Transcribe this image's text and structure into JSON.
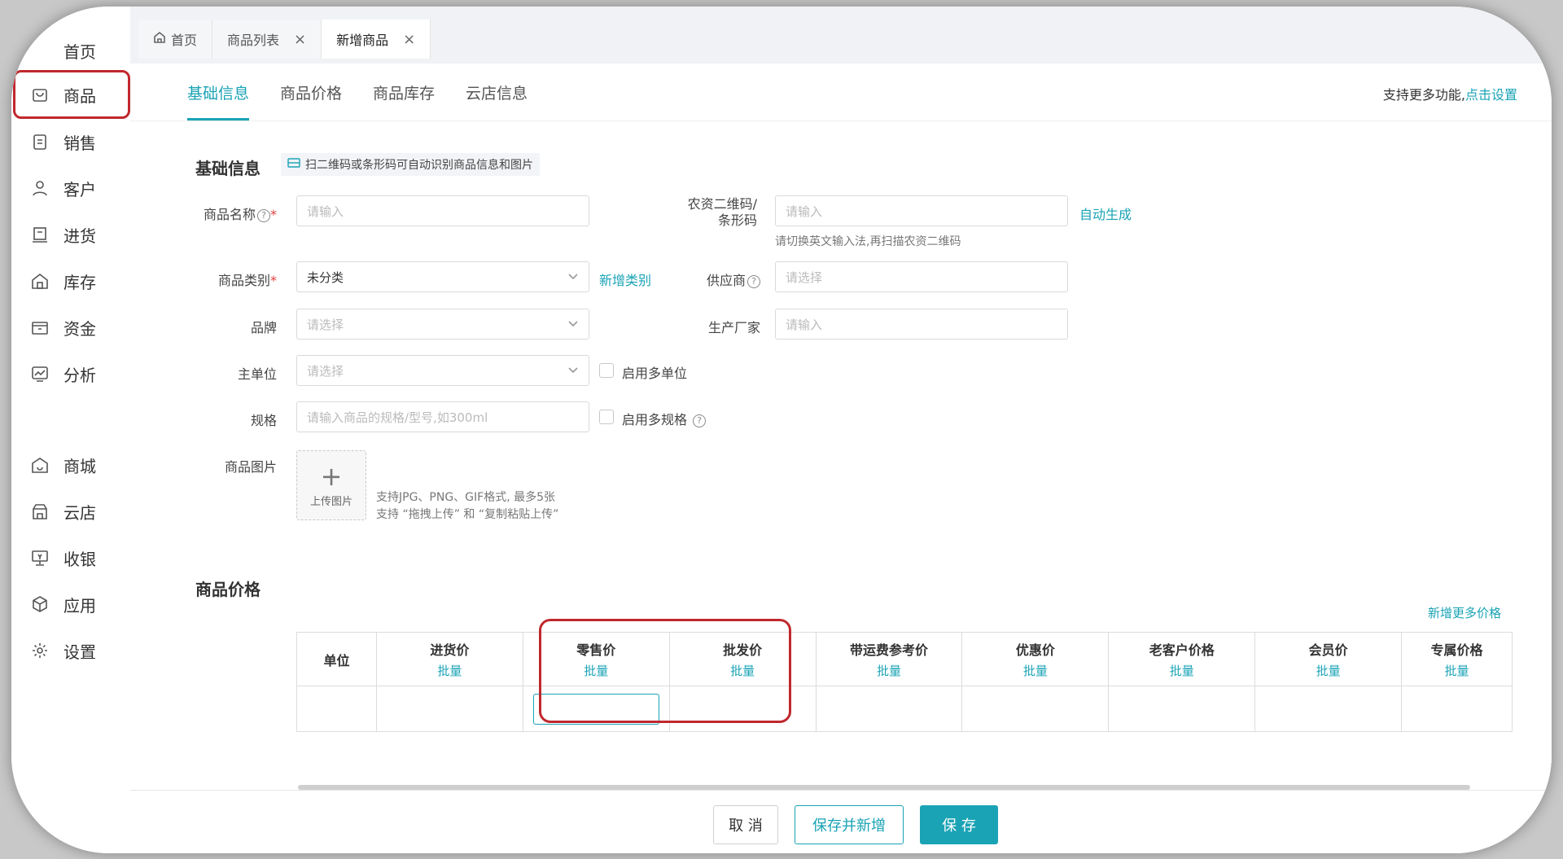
{
  "sidebar": {
    "home": "首页",
    "items": [
      {
        "label": "商品",
        "icon": "bag-icon"
      },
      {
        "label": "销售",
        "icon": "clipboard-icon"
      },
      {
        "label": "客户",
        "icon": "user-icon"
      },
      {
        "label": "进货",
        "icon": "purchase-icon"
      },
      {
        "label": "库存",
        "icon": "warehouse-icon"
      },
      {
        "label": "资金",
        "icon": "wallet-icon"
      },
      {
        "label": "分析",
        "icon": "chart-icon"
      },
      {
        "label": "商城",
        "icon": "mall-icon"
      },
      {
        "label": "云店",
        "icon": "cloud-store-icon"
      },
      {
        "label": "收银",
        "icon": "cashier-icon"
      },
      {
        "label": "应用",
        "icon": "cube-icon"
      },
      {
        "label": "设置",
        "icon": "gear-icon"
      }
    ]
  },
  "tabs": {
    "home": "首页",
    "product_list": "商品列表",
    "new_product": "新增商品",
    "close": "×"
  },
  "subtabs": [
    "基础信息",
    "商品价格",
    "商品库存",
    "云店信息"
  ],
  "more_func": {
    "text": "支持更多功能,",
    "link": "点击设置"
  },
  "basic": {
    "title": "基础信息",
    "scan_tip": "扫二维码或条形码可自动识别商品信息和图片",
    "name_label": "商品名称",
    "name_placeholder": "请输入",
    "qrcode_label_1": "农资二维码/",
    "qrcode_label_2": "条形码",
    "qrcode_placeholder": "请输入",
    "auto_generate": "自动生成",
    "qrcode_hint": "请切换英文输入法,再扫描农资二维码",
    "category_label": "商品类别",
    "category_value": "未分类",
    "add_category": "新增类别",
    "supplier_label": "供应商",
    "supplier_placeholder": "请选择",
    "brand_label": "品牌",
    "brand_placeholder": "请选择",
    "manufacturer_label": "生产厂家",
    "manufacturer_placeholder": "请输入",
    "unit_label": "主单位",
    "unit_placeholder": "请选择",
    "multi_unit": "启用多单位",
    "spec_label": "规格",
    "spec_placeholder": "请输入商品的规格/型号,如300ml",
    "multi_spec": "启用多规格",
    "image_label": "商品图片",
    "upload": "上传图片",
    "upload_hint_1": "支持JPG、PNG、GIF格式, 最多5张",
    "upload_hint_2": "支持 “拖拽上传” 和 “复制粘贴上传”"
  },
  "price": {
    "title": "商品价格",
    "add_more": "新增更多价格",
    "batch": "批量",
    "columns": [
      "单位",
      "进货价",
      "零售价",
      "批发价",
      "带运费参考价",
      "优惠价",
      "老客户价格",
      "会员价",
      "专属价格"
    ]
  },
  "footer": {
    "cancel": "取 消",
    "save_new": "保存并新增",
    "save": "保 存"
  },
  "colors": {
    "accent": "#1aa3b5",
    "highlight": "#c0282d"
  }
}
